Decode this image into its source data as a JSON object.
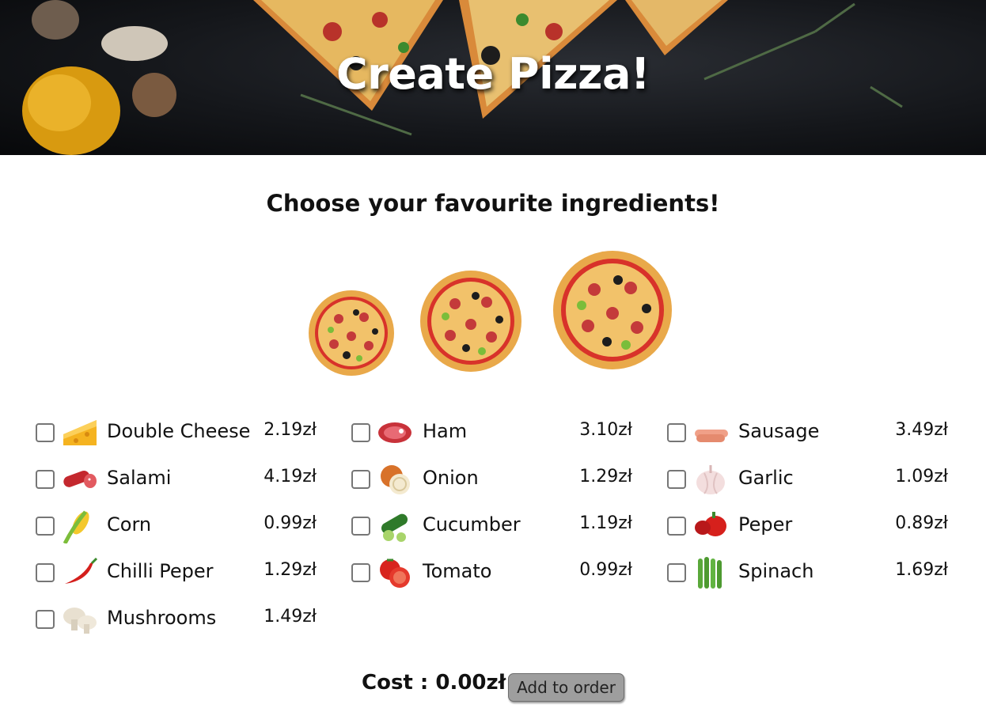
{
  "header": {
    "title": "Create Pizza!"
  },
  "subtitle": "Choose your favourite ingredients!",
  "sizes": [
    "small-pizza",
    "medium-pizza",
    "large-pizza"
  ],
  "ingredients": [
    {
      "name": "Double Cheese",
      "price": "2.19zł",
      "icon": "cheese-icon"
    },
    {
      "name": "Ham",
      "price": "3.10zł",
      "icon": "ham-icon"
    },
    {
      "name": "Sausage",
      "price": "3.49zł",
      "icon": "sausage-icon"
    },
    {
      "name": "Salami",
      "price": "4.19zł",
      "icon": "salami-icon"
    },
    {
      "name": "Onion",
      "price": "1.29zł",
      "icon": "onion-icon"
    },
    {
      "name": "Garlic",
      "price": "1.09zł",
      "icon": "garlic-icon"
    },
    {
      "name": "Corn",
      "price": "0.99zł",
      "icon": "corn-icon"
    },
    {
      "name": "Cucumber",
      "price": "1.19zł",
      "icon": "cucumber-icon"
    },
    {
      "name": "Peper",
      "price": "0.89zł",
      "icon": "bell-pepper-icon"
    },
    {
      "name": "Chilli Peper",
      "price": "1.29zł",
      "icon": "chilli-icon"
    },
    {
      "name": "Tomato",
      "price": "0.99zł",
      "icon": "tomato-icon"
    },
    {
      "name": "Spinach",
      "price": "1.69zł",
      "icon": "spinach-icon"
    },
    {
      "name": "Mushrooms",
      "price": "1.49zł",
      "icon": "mushroom-icon"
    }
  ],
  "footer": {
    "cost_label": "Cost : 0.00zł",
    "add_button": "Add to order"
  },
  "colors": {
    "button_bg": "#9e9e9e",
    "text": "#111111"
  }
}
